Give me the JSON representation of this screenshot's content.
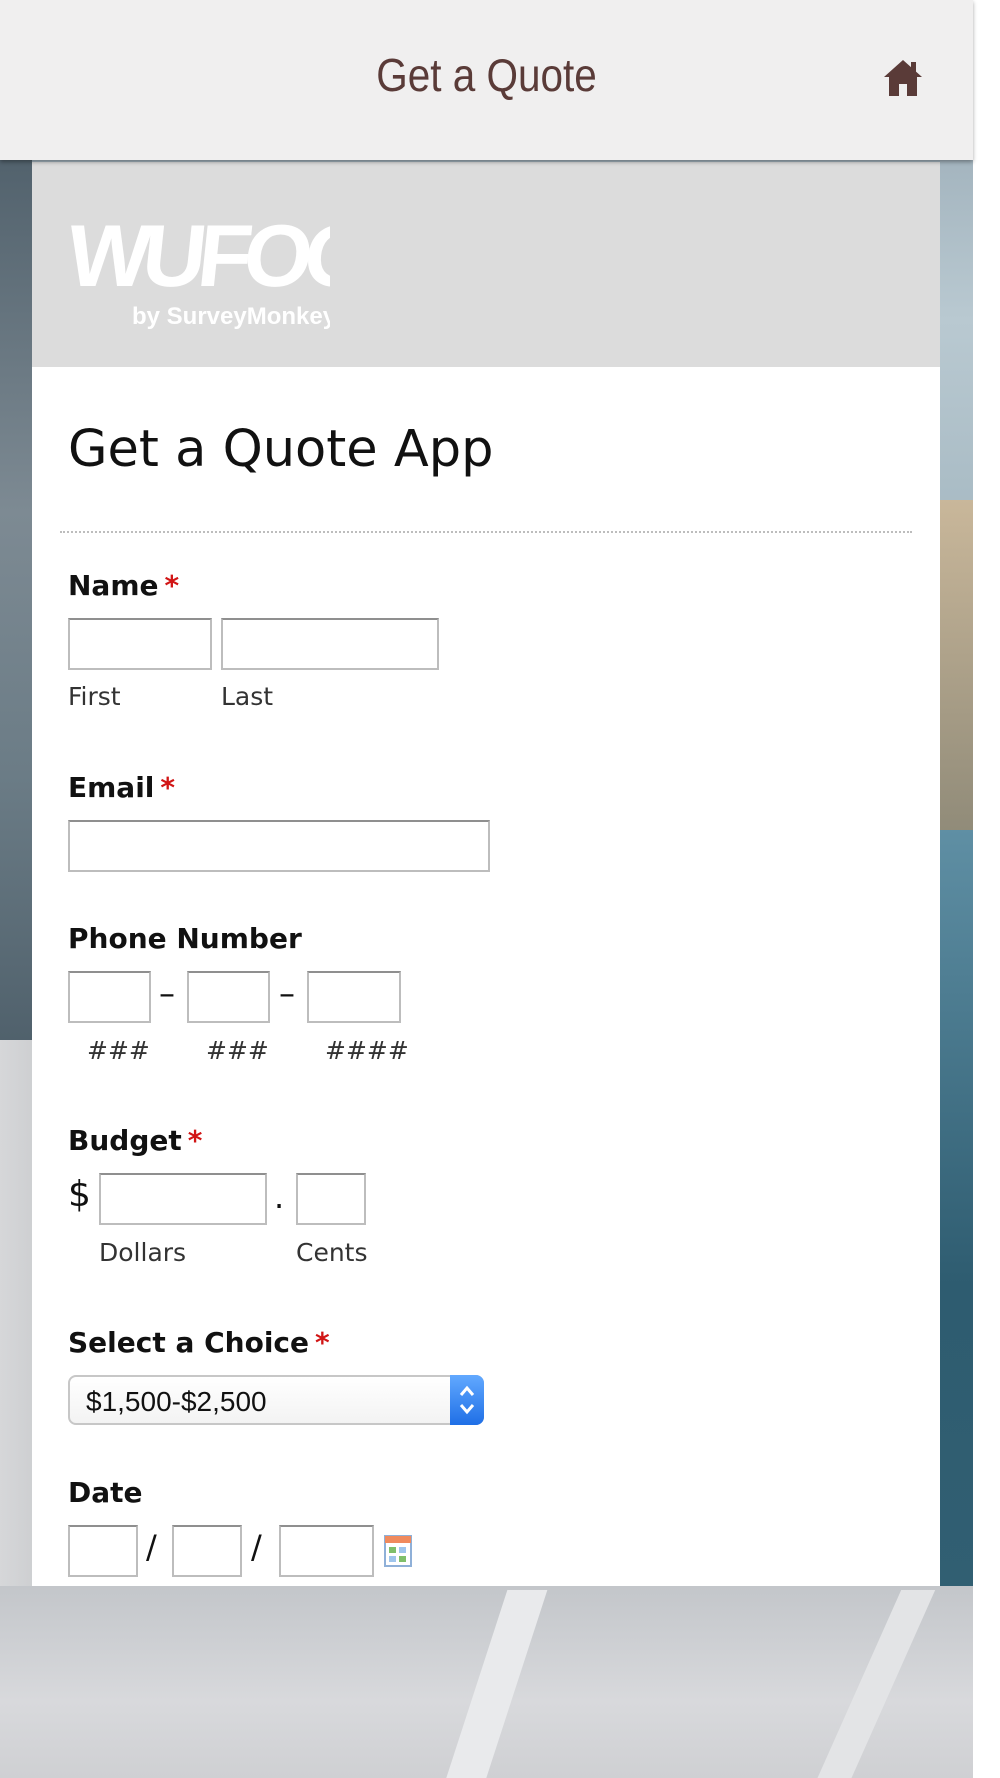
{
  "header": {
    "title": "Get a Quote",
    "home_icon": "home-icon"
  },
  "brand": {
    "logo_word": "WUFOO",
    "logo_tagline": "by SurveyMonkey"
  },
  "form": {
    "title": "Get a Quote App",
    "required_marker": "*",
    "name": {
      "label": "Name",
      "first_sublabel": "First",
      "last_sublabel": "Last"
    },
    "email": {
      "label": "Email"
    },
    "phone": {
      "label": "Phone Number",
      "sep": "–",
      "part1_sublabel": "###",
      "part2_sublabel": "###",
      "part3_sublabel": "####"
    },
    "budget": {
      "label": "Budget",
      "currency": "$",
      "decimal": ".",
      "dollars_sublabel": "Dollars",
      "cents_sublabel": "Cents"
    },
    "choice": {
      "label": "Select a Choice",
      "selected": "$1,500-$2,500"
    },
    "date": {
      "label": "Date",
      "sep": "/"
    }
  },
  "colors": {
    "header_text": "#5a3b38",
    "required": "#d11515",
    "select_accent": "#1f6fe6"
  }
}
